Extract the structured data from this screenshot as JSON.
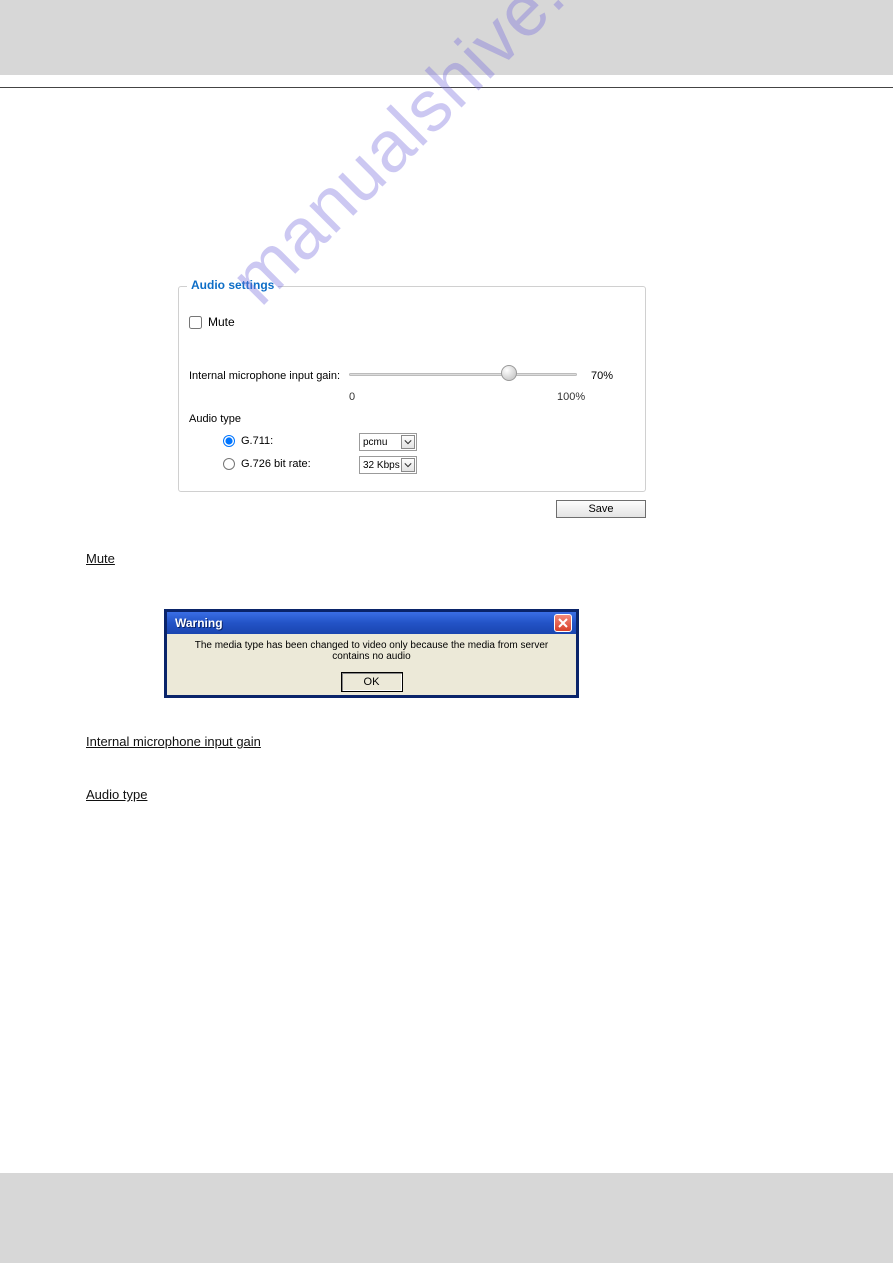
{
  "watermark": "manualshive.com",
  "fieldset": {
    "legend": "Audio settings",
    "mute_label": "Mute",
    "gain_label": "Internal microphone input gain:",
    "slider": {
      "min_label": "0",
      "max_label": "100%",
      "value_label": "70%"
    },
    "audiotype_label": "Audio type",
    "g711_label": "G.711:",
    "g711_value": "pcmu",
    "g726_label": "G.726 bit rate:",
    "g726_value": "32 Kbps"
  },
  "save_label": "Save",
  "text_mute": "Mute",
  "text_gain": "Internal microphone input gain",
  "text_audiotype": "Audio type",
  "dialog": {
    "title": "Warning",
    "message": "The media type has been changed to video only because the media from server contains no audio",
    "ok": "OK"
  }
}
